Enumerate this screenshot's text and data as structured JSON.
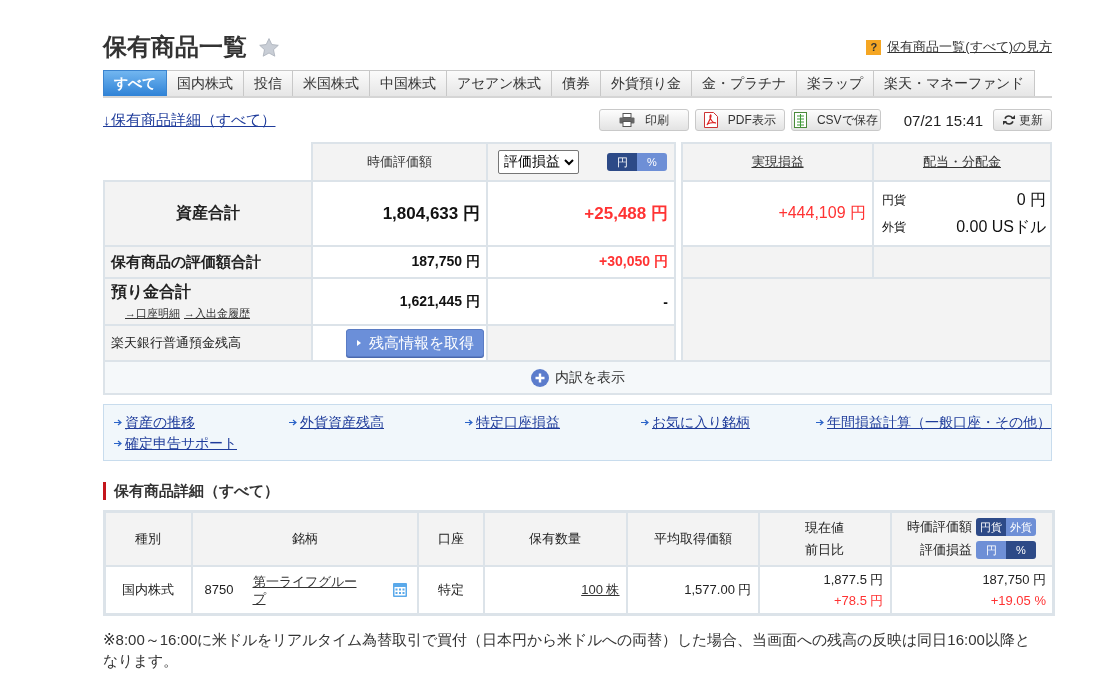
{
  "header": {
    "title": "保有商品一覧",
    "help_icon": "?",
    "help_link": "保有商品一覧(すべて)の見方"
  },
  "tabs": [
    {
      "label": "すべて",
      "selected": true
    },
    {
      "label": "国内株式",
      "selected": false
    },
    {
      "label": "投信",
      "selected": false
    },
    {
      "label": "米国株式",
      "selected": false
    },
    {
      "label": "中国株式",
      "selected": false
    },
    {
      "label": "アセアン株式",
      "selected": false
    },
    {
      "label": "債券",
      "selected": false
    },
    {
      "label": "外貨預り金",
      "selected": false
    },
    {
      "label": "金・プラチナ",
      "selected": false
    },
    {
      "label": "楽ラップ",
      "selected": false
    },
    {
      "label": "楽天・マネーファンド",
      "selected": false
    }
  ],
  "toolbar": {
    "detail_link": "↓保有商品詳細（すべて）",
    "buttons": [
      {
        "kind": "print",
        "label": "印刷"
      },
      {
        "kind": "pdf",
        "label": "PDF表示"
      },
      {
        "kind": "csv",
        "label": "CSVで保存"
      }
    ],
    "timestamp": "07/21 15:41",
    "refresh": "更新"
  },
  "summary": {
    "columns": {
      "market_value": "時価評価額",
      "pl_select": "評価損益",
      "pl_units": [
        {
          "label": "円",
          "selected": true
        },
        {
          "label": "%",
          "selected": false
        }
      ],
      "realized": "実現損益",
      "dividends": "配当・分配金"
    },
    "rows": [
      {
        "kind": "total",
        "label": "資産合計",
        "market_value": "1,804,633 円",
        "pl": {
          "text": "+25,488 円",
          "gain": true
        },
        "realized": {
          "text": "+444,109 円",
          "gain": true
        },
        "dividends": [
          {
            "label": "円貨",
            "value": "0 円"
          },
          {
            "label": "外貨",
            "value": "0.00 USドル"
          }
        ]
      },
      {
        "kind": "holdings",
        "label": "保有商品の評価額合計",
        "market_value": "187,750 円",
        "pl": {
          "text": "+30,050 円",
          "gain": true
        }
      },
      {
        "kind": "deposit",
        "label": "預り金合計",
        "links": [
          "→口座明細",
          "→入出金履歴"
        ],
        "market_value": "1,621,445 円",
        "pl": {
          "text": "-",
          "gain": false
        }
      },
      {
        "kind": "bank",
        "label": "楽天銀行普通預金残高",
        "button": "残高情報を取得"
      }
    ],
    "expand": "内訳を表示"
  },
  "quick_links": [
    "資産の推移",
    "外貨資産残高",
    "特定口座損益",
    "お気に入り銘柄",
    "年間損益計算（一般口座・その他）",
    "確定申告サポート"
  ],
  "holdings": {
    "title": "保有商品詳細（すべて）",
    "columns": {
      "type": "種別",
      "name": "銘柄",
      "account": "口座",
      "quantity": "保有数量",
      "avg_cost": "平均取得価額",
      "price": "現在値",
      "change": "前日比",
      "value": "時価評価額",
      "value_units": [
        {
          "label": "円貨",
          "selected": true
        },
        {
          "label": "外貨",
          "selected": false
        }
      ],
      "pl": "評価損益",
      "pl_units": [
        {
          "label": "円",
          "selected": false
        },
        {
          "label": "%",
          "selected": true
        }
      ]
    },
    "rows": [
      {
        "type": "国内株式",
        "code": "8750",
        "name": "第一ライフグループ",
        "account": "特定",
        "quantity": "100 株",
        "avg_cost": "1,577.00 円",
        "price": "1,877.5 円",
        "change": {
          "text": "+78.5 円",
          "gain": true
        },
        "value": "187,750 円",
        "pl": {
          "text": "+19.05 %",
          "gain": true
        }
      }
    ]
  },
  "note": "※8:00～16:00に米ドルをリアルタイム為替取引で買付（日本円から米ドルへの両替）した場合、当画面への残高の反映は同日16:00以降となります。"
}
